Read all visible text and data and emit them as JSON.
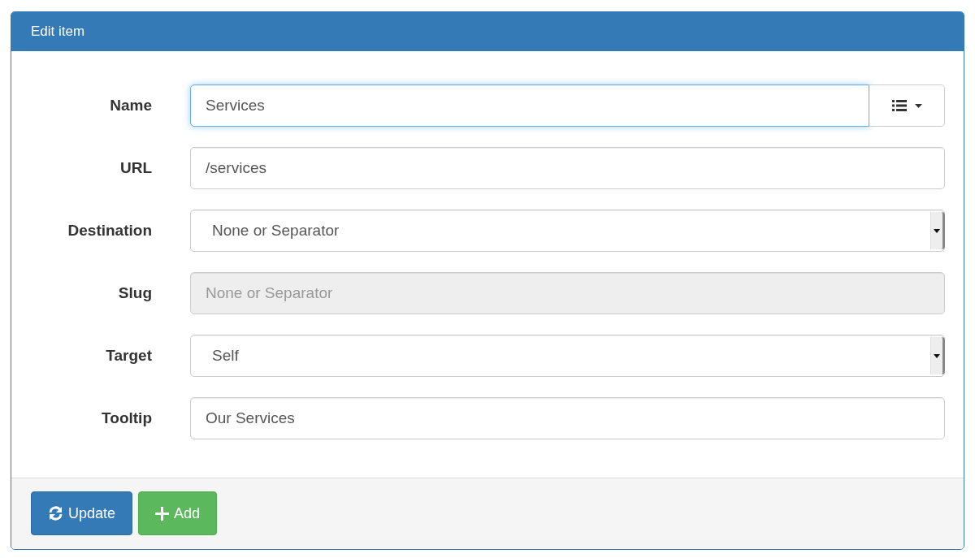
{
  "panel": {
    "title": "Edit item"
  },
  "fields": [
    {
      "label": "Name",
      "kind": "text_with_menu",
      "value": "Services",
      "focused": true
    },
    {
      "label": "URL",
      "kind": "text",
      "value": "/services",
      "focused": false
    },
    {
      "label": "Destination",
      "kind": "select",
      "value": "None or Separator",
      "focused": false
    },
    {
      "label": "Slug",
      "kind": "disabled",
      "value": "None or Separator",
      "focused": false
    },
    {
      "label": "Target",
      "kind": "select",
      "value": "Self",
      "focused": false
    },
    {
      "label": "Tooltip",
      "kind": "text",
      "value": "Our Services",
      "focused": false
    }
  ],
  "buttons": [
    {
      "label": "Update",
      "kind": "update"
    },
    {
      "label": "Add",
      "kind": "add"
    }
  ]
}
